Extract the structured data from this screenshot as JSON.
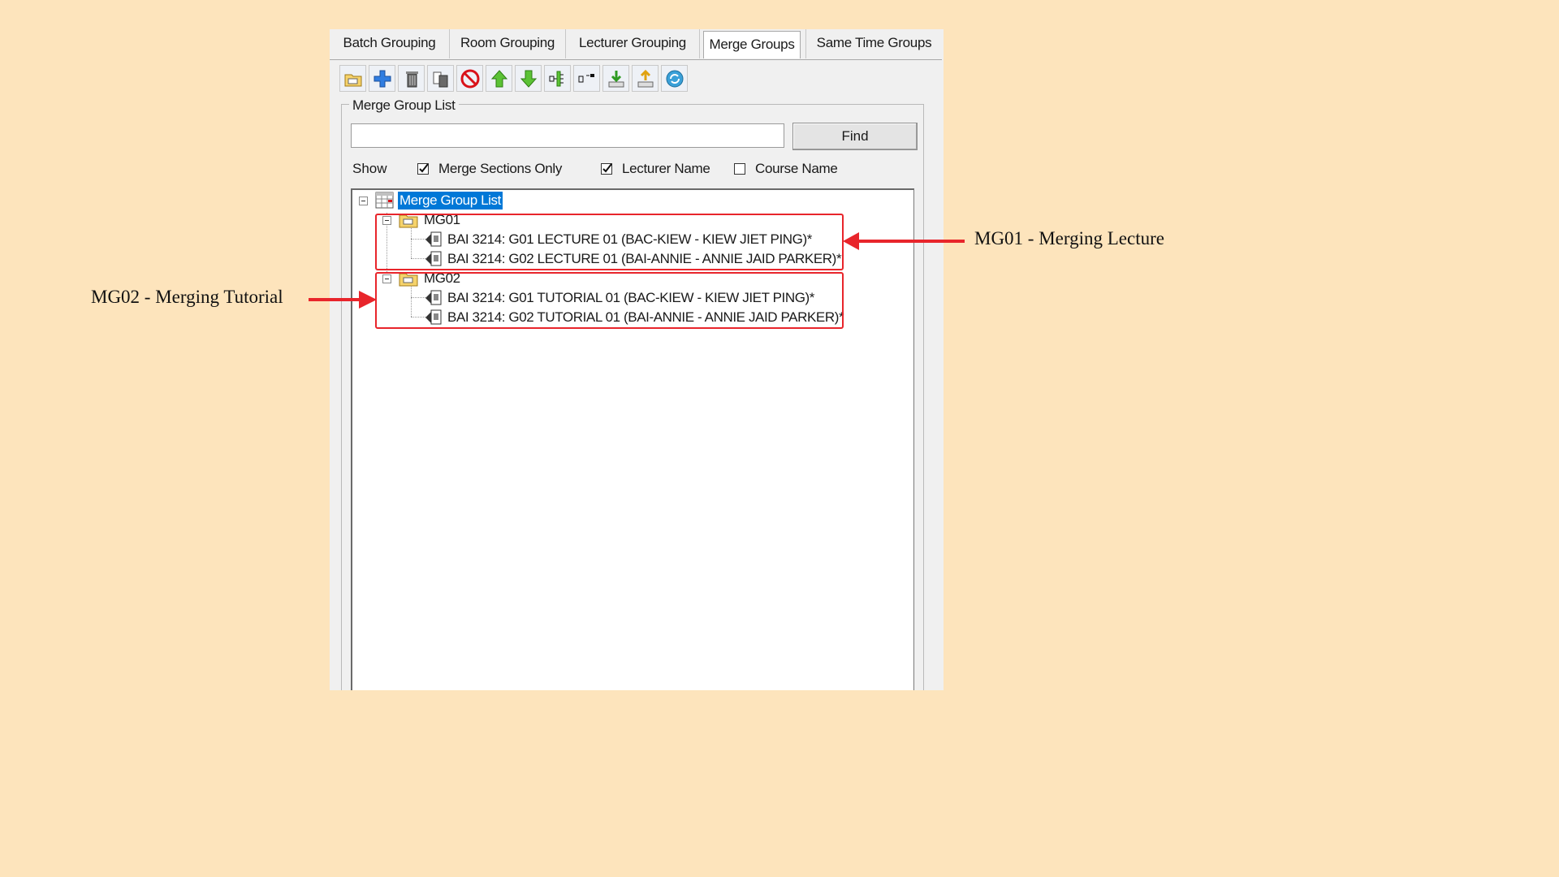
{
  "tabs": [
    {
      "label": "Batch Grouping",
      "active": false
    },
    {
      "label": "Room Grouping",
      "active": false
    },
    {
      "label": "Lecturer Grouping",
      "active": false
    },
    {
      "label": "Merge Groups",
      "active": true
    },
    {
      "label": "Same Time Groups",
      "active": false
    }
  ],
  "toolbar": {
    "buttons": [
      "open-folder-icon",
      "add-icon",
      "delete-icon",
      "copy-delete-icon",
      "stop-icon",
      "move-up-icon",
      "move-down-icon",
      "merge-icon",
      "split-icon",
      "import-icon",
      "export-icon",
      "refresh-icon"
    ]
  },
  "merge_group_list": {
    "legend": "Merge Group List",
    "search_value": "",
    "find_label": "Find"
  },
  "show": {
    "label": "Show",
    "merge_sections_only": {
      "label": "Merge Sections Only",
      "checked": true
    },
    "lecturer_name": {
      "label": "Lecturer Name",
      "checked": true
    },
    "course_name": {
      "label": "Course Name",
      "checked": false
    }
  },
  "tree": {
    "root": "Merge Group List",
    "groups": [
      {
        "name": "MG01",
        "items": [
          "BAI 3214: G01 LECTURE  01 (BAC-KIEW - KIEW JIET PING)*",
          "BAI 3214: G02 LECTURE 01 (BAI-ANNIE - ANNIE JAID PARKER)*"
        ]
      },
      {
        "name": "MG02",
        "items": [
          "BAI 3214: G01 TUTORIAL  01 (BAC-KIEW - KIEW JIET PING)*",
          "BAI 3214: G02 TUTORIAL 01 (BAI-ANNIE - ANNIE JAID PARKER)*"
        ]
      }
    ]
  },
  "annotations": {
    "mg01": "MG01 - Merging Lecture",
    "mg02": "MG02 - Merging Tutorial",
    "color": "#e8252b"
  },
  "colors": {
    "background": "#fde4bc",
    "selection": "#0078d7"
  }
}
